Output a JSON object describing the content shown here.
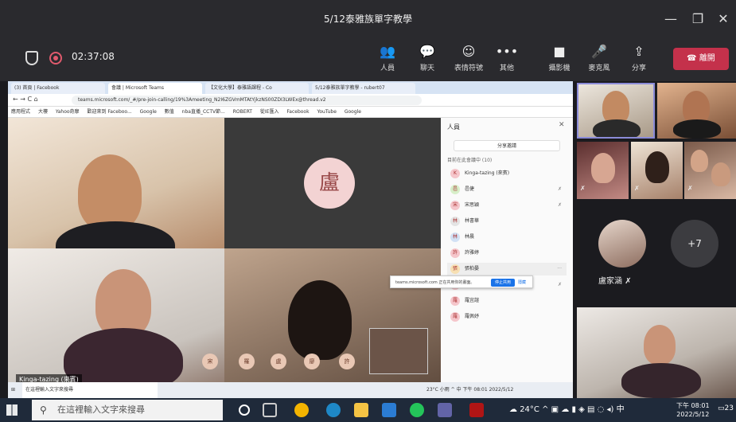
{
  "window": {
    "title": "5/12泰雅族單字教學"
  },
  "meeting": {
    "timer": "02:37:08",
    "toolbar": [
      {
        "label": "人員",
        "icon": "people-icon",
        "glyph": "👥"
      },
      {
        "label": "聊天",
        "icon": "chat-icon",
        "glyph": "💬"
      },
      {
        "label": "表情符號",
        "icon": "reactions-icon",
        "glyph": "☺"
      },
      {
        "label": "其他",
        "icon": "more-icon",
        "glyph": "•••"
      },
      {
        "label": "攝影機",
        "icon": "camera-icon",
        "glyph": "■"
      },
      {
        "label": "麥克風",
        "icon": "mic-icon",
        "glyph": "🎤"
      },
      {
        "label": "分享",
        "icon": "share-icon",
        "glyph": "⇪"
      }
    ],
    "leave_label": "離開"
  },
  "browser": {
    "tabs": [
      "(3) 首頁 | Facebook",
      "會議 | Microsoft Teams",
      "【文化大學】泰雅語課程 - Co",
      "5/12泰雅族單字教學 - rubert07"
    ],
    "url": "teams.microsoft.com/_#/pre-join-calling/19%3Ameeting_N2I6ZGVmMTAtYjkzNS00ZDI3LWEx@thread.v2",
    "bookmarks": [
      "應用程式",
      "大樓",
      "Yahoo奇摩",
      "歡迎來到 Faceboo...",
      "Google",
      "數值",
      "nba直播_CCTV節...",
      "ROBERT",
      "從IE匯入",
      "Facebook",
      "YouTube",
      "Google"
    ]
  },
  "inner": {
    "big_avatar": "盧",
    "people_title": "人員",
    "share_invite": "分享邀請",
    "in_meeting": "目前在此會議中 (10)",
    "participants": [
      "Kinga-tazing (來賓)",
      "邑倢",
      "宋思穎",
      "林書華",
      "林晨",
      "許雅婷",
      "張柏晏",
      "盧家涵",
      "羅宜諠",
      "羅佩妤"
    ],
    "notice": "teams.microsoft.com 正在共用你的畫面。",
    "notice_button": "停止共用",
    "notice_hide": "隱藏",
    "reactions": [
      "宋",
      "羅",
      "盧",
      "廖",
      "許"
    ],
    "name_tag": "Kinga-tazing (來賓)",
    "taskbar_text": "在這裡輸入文字來搜尋",
    "taskbar_tray": "23°C 小雨  ^  中  下午 08:01  2022/5/12"
  },
  "gallery": {
    "named_participant": "盧家涵",
    "overflow": "+7"
  },
  "taskbar": {
    "search_placeholder": "在這裡輸入文字來搜尋",
    "weather": "24°C",
    "ime": "中",
    "time": "下午 08:01",
    "date": "2022/5/12",
    "notifications": "23"
  }
}
